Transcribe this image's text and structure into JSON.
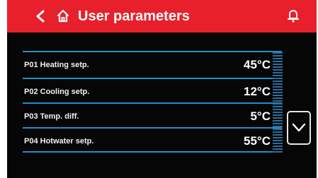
{
  "header": {
    "title": "User parameters",
    "back_icon": "chevron-left",
    "home_icon": "home",
    "notify_icon": "bell"
  },
  "parameters": [
    {
      "label": "P01 Heating setp.",
      "value": "45°C"
    },
    {
      "label": "P02 Cooling setp.",
      "value": "12°C"
    },
    {
      "label": "P03 Temp. diff.",
      "value": "5°C"
    },
    {
      "label": "P04 Hotwater setp.",
      "value": "55°C"
    }
  ],
  "scroll": {
    "icon": "chevron-down"
  },
  "colors": {
    "header_bg": "#e8202c",
    "screen_bg": "#060606",
    "divider": "#1e8fc8",
    "text": "#ffffff"
  }
}
